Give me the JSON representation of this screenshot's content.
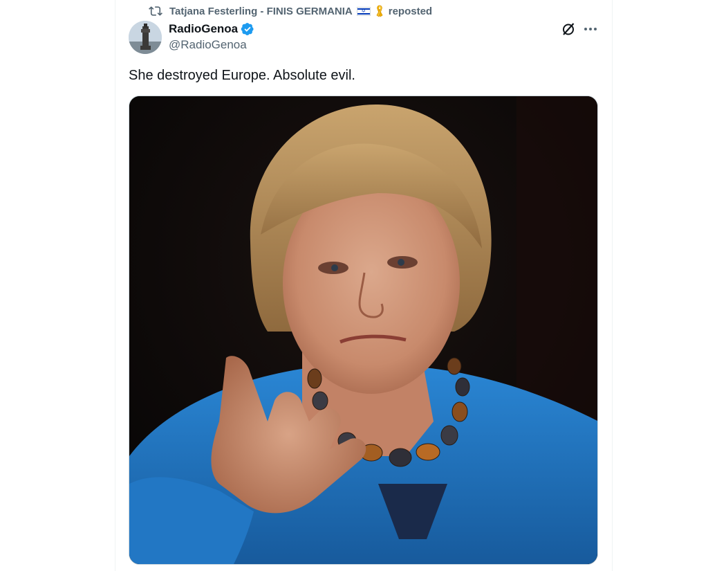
{
  "repost": {
    "icon": "repost-icon",
    "user": "Tatjana Festerling - FINIS GERMANIA",
    "flag": "israel-flag-emoji",
    "ribbon": "yellow-ribbon-emoji",
    "suffix": "reposted"
  },
  "author": {
    "display_name": "RadioGenoa",
    "verified": true,
    "handle": "@RadioGenoa"
  },
  "actions": {
    "grok_icon": "grok-icon",
    "more_icon": "more-icon"
  },
  "tweet": {
    "text": "She destroyed Europe. Absolute evil."
  },
  "media": {
    "description_icon": "photo"
  },
  "colors": {
    "text_primary": "#0f1419",
    "text_secondary": "#536471",
    "verified_blue": "#1d9bf0",
    "jacket_blue": "#1f74c4"
  }
}
